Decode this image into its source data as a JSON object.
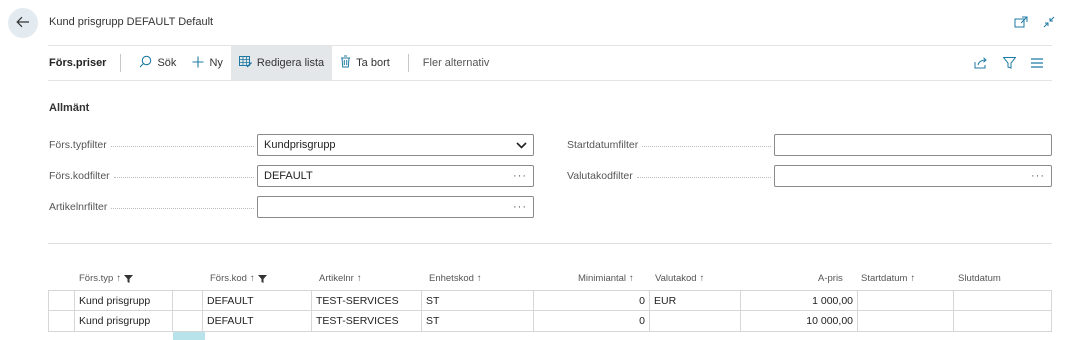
{
  "header": {
    "title": "Kund prisgrupp DEFAULT Default"
  },
  "actions": {
    "tab_title": "Förs.priser",
    "search": "Sök",
    "new": "Ny",
    "edit_list": "Redigera lista",
    "delete": "Ta bort",
    "more": "Fler alternativ"
  },
  "general": {
    "title": "Allmänt",
    "fields": {
      "sales_type_filter": {
        "label": "Förs.typfilter",
        "value": "Kundprisgrupp"
      },
      "sales_code_filter": {
        "label": "Förs.kodfilter",
        "value": "DEFAULT"
      },
      "item_no_filter": {
        "label": "Artikelnrfilter",
        "value": ""
      },
      "start_date_filter": {
        "label": "Startdatumfilter",
        "value": ""
      },
      "currency_code_filter": {
        "label": "Valutakodfilter",
        "value": ""
      }
    }
  },
  "grid": {
    "columns": {
      "sales_type": "Förs.typ",
      "sales_code": "Förs.kod",
      "item_no": "Artikelnr",
      "unit_code": "Enhetskod",
      "min_qty": "Minimiantal",
      "currency": "Valutakod",
      "unit_price": "A-pris",
      "start_date": "Startdatum",
      "end_date": "Slutdatum"
    },
    "sort_arrow": "↑",
    "rows": [
      {
        "sales_type": "Kund prisgrupp",
        "sales_code": "DEFAULT",
        "item_no": "TEST-SERVICES",
        "unit_code": "ST",
        "min_qty": "0",
        "currency": "EUR",
        "unit_price": "1 000,00",
        "start_date": "",
        "end_date": ""
      },
      {
        "sales_type": "Kund prisgrupp",
        "sales_code": "DEFAULT",
        "item_no": "TEST-SERVICES",
        "unit_code": "ST",
        "min_qty": "0",
        "currency": "",
        "unit_price": "10 000,00",
        "start_date": "",
        "end_date": ""
      }
    ]
  },
  "colors": {
    "accent": "#1f7aa3",
    "active_bg": "#e4e7ea",
    "selection": "#b9e3ea"
  }
}
